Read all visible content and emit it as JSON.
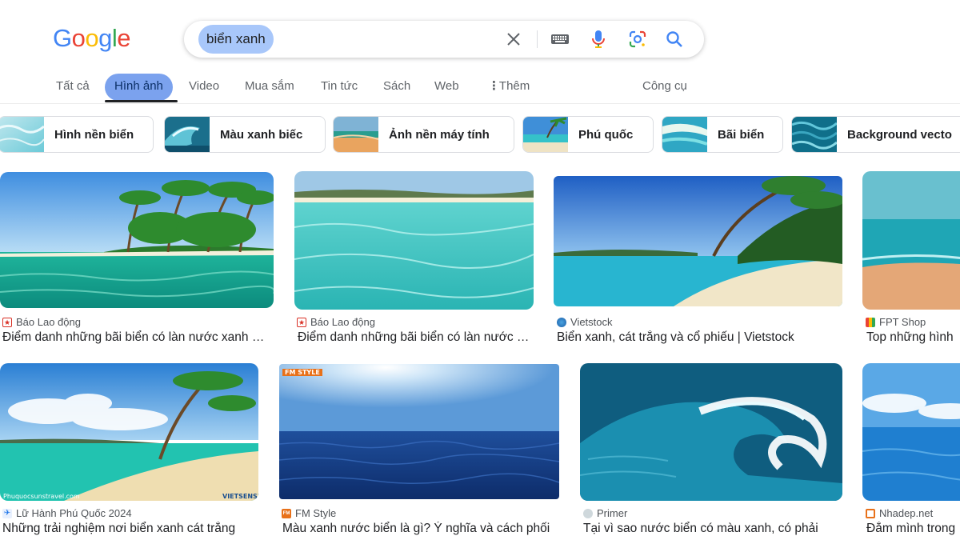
{
  "logo": {
    "text": "Google",
    "colors": [
      "#4285f4",
      "#ea4335",
      "#fbbc05",
      "#4285f4",
      "#34a853",
      "#ea4335"
    ]
  },
  "search": {
    "query": "biển xanh",
    "icons": [
      "close-icon",
      "keyboard-icon",
      "microphone-icon",
      "lens-icon",
      "search-icon"
    ]
  },
  "tabs": [
    {
      "label": "Tất cả"
    },
    {
      "label": "Hình ảnh",
      "active": true
    },
    {
      "label": "Video"
    },
    {
      "label": "Mua sắm"
    },
    {
      "label": "Tin tức"
    },
    {
      "label": "Sách"
    },
    {
      "label": "Web"
    },
    {
      "label": "Thêm",
      "icon": "more-vert-icon"
    },
    {
      "label": "Công cụ"
    }
  ],
  "related_chips": [
    {
      "label": "Hình nền biển"
    },
    {
      "label": "Màu xanh biếc"
    },
    {
      "label": "Ảnh nền máy tính"
    },
    {
      "label": "Phú quốc"
    },
    {
      "label": "Bãi biển"
    },
    {
      "label": "Background vecto"
    }
  ],
  "results": [
    {
      "source": "Báo Lao động",
      "title": "Điểm danh những bãi biển có làn nước xanh ngắt"
    },
    {
      "source": "Báo Lao động",
      "title": "Điểm danh những bãi biển có làn nước xanh biếc"
    },
    {
      "source": "Vietstock",
      "title": "Biển xanh, cát trắng và cổ phiếu | Vietstock"
    },
    {
      "source": "FPT Shop",
      "title": "Top những hình"
    },
    {
      "source": "Lữ Hành Phú Quốc 2024",
      "title": "Những trải nghiệm nơi biển xanh cát trắng",
      "watermark_left": "Phuquocsunstravel.com",
      "watermark_right": "VIETSENSE"
    },
    {
      "source": "FM Style",
      "title": "Màu xanh nước biển là gì? Ý nghĩa và cách phối",
      "watermark_left": "FM STYLE"
    },
    {
      "source": "Primer",
      "title": "Tại vì sao nước biển có màu xanh, có phải"
    },
    {
      "source": "Nhadep.net",
      "title": "Đắm mình trong"
    }
  ],
  "colors": {
    "accent": "#1a73e8",
    "active_tab_bg": "#7ba2ee",
    "query_chip_bg": "#a8c7fa"
  }
}
